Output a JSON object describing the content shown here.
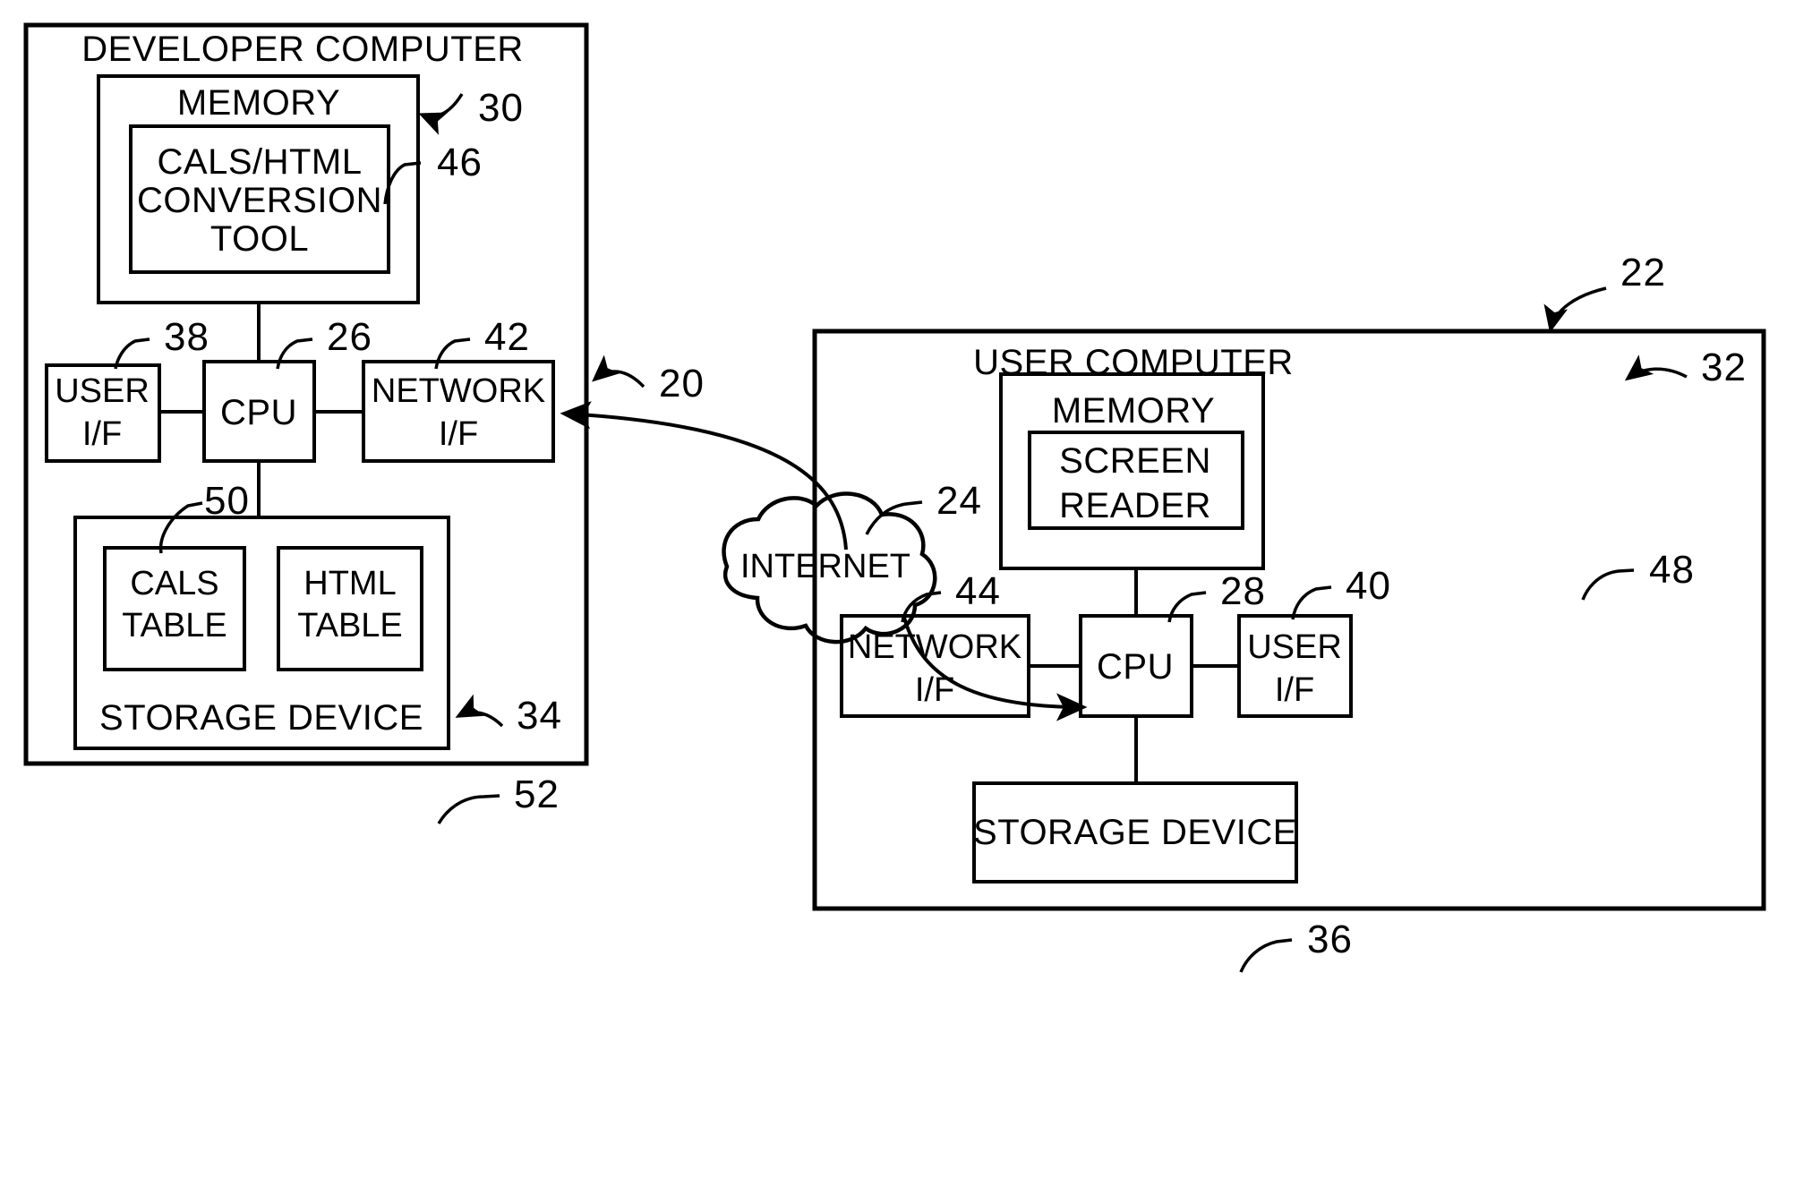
{
  "figure": {
    "type": "patent-block-diagram",
    "background_color": "#ffffff",
    "line_color": "#000000"
  },
  "developer_computer": {
    "title": "DEVELOPER COMPUTER",
    "ref": "20",
    "memory": {
      "title": "MEMORY",
      "ref": "30",
      "tool": {
        "line1": "CALS/HTML",
        "line2": "CONVERSION",
        "line3": "TOOL",
        "ref": "46"
      }
    },
    "user_if": {
      "line1": "USER",
      "line2": "I/F",
      "ref": "38"
    },
    "cpu": {
      "label": "CPU",
      "ref": "26"
    },
    "network_if": {
      "line1": "NETWORK",
      "line2": "I/F",
      "ref": "42"
    },
    "storage": {
      "title": "STORAGE DEVICE",
      "ref": "34",
      "cals_table": {
        "line1": "CALS",
        "line2": "TABLE",
        "ref": "50"
      },
      "html_table": {
        "line1": "HTML",
        "line2": "TABLE",
        "ref": "52"
      }
    }
  },
  "internet": {
    "label": "INTERNET",
    "ref": "24"
  },
  "user_computer": {
    "title": "USER COMPUTER",
    "ref": "22",
    "memory": {
      "title": "MEMORY",
      "ref": "32",
      "screen_reader": {
        "line1": "SCREEN",
        "line2": "READER",
        "ref": "48"
      }
    },
    "network_if": {
      "line1": "NETWORK",
      "line2": "I/F",
      "ref": "44"
    },
    "cpu": {
      "label": "CPU",
      "ref": "28"
    },
    "user_if": {
      "line1": "USER",
      "line2": "I/F",
      "ref": "40"
    },
    "storage": {
      "title": "STORAGE DEVICE",
      "ref": "36"
    }
  }
}
